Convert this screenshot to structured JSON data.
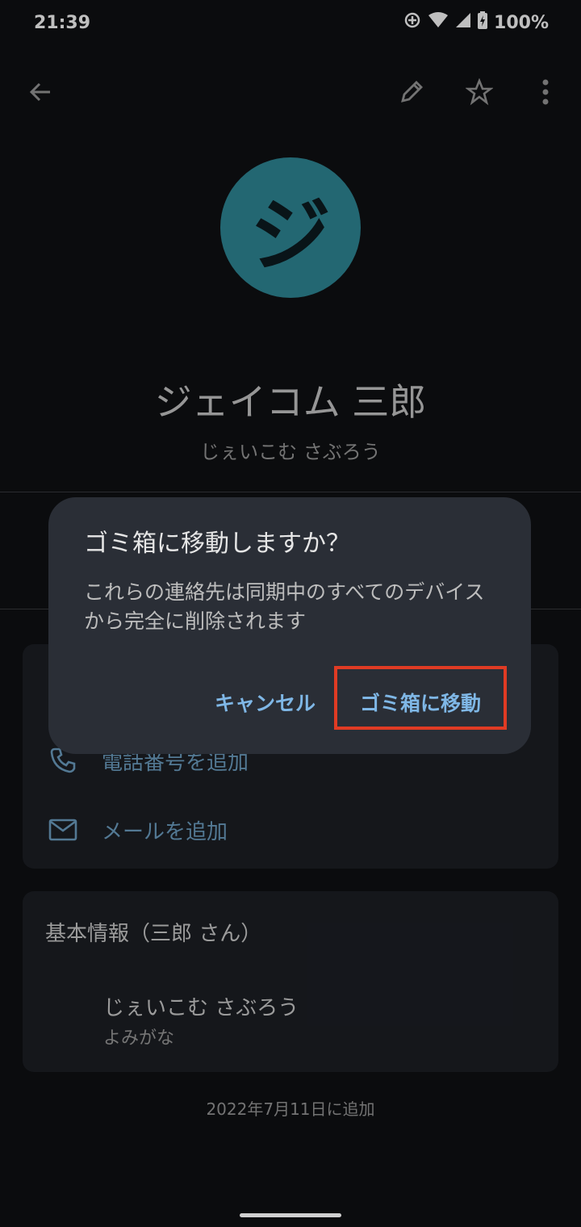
{
  "status_bar": {
    "time": "21:39",
    "battery": "100%"
  },
  "app_bar": {
    "back": "back-arrow-icon",
    "edit": "pencil-icon",
    "favorite": "star-outline-icon",
    "more": "more-vert-icon"
  },
  "contact": {
    "avatar_letter": "ジ",
    "avatar_color": "#2f8a99",
    "name": "ジェイコム 三郎",
    "phonetic": "じぇいこむ さぶろう"
  },
  "actions": {
    "add_phone": "電話番号を追加",
    "add_email": "メールを追加"
  },
  "basic_info": {
    "title": "基本情報（三郎 さん）",
    "phonetic_value": "じぇいこむ さぶろう",
    "phonetic_label": "よみがな"
  },
  "added_date": "2022年7月11日に追加",
  "dialog": {
    "title": "ゴミ箱に移動しますか？",
    "body": "これらの連絡先は同期中のすべてのデバイスから完全に削除されます",
    "cancel": "キャンセル",
    "confirm": "ゴミ箱に移動",
    "highlight_color": "#e03b24"
  }
}
